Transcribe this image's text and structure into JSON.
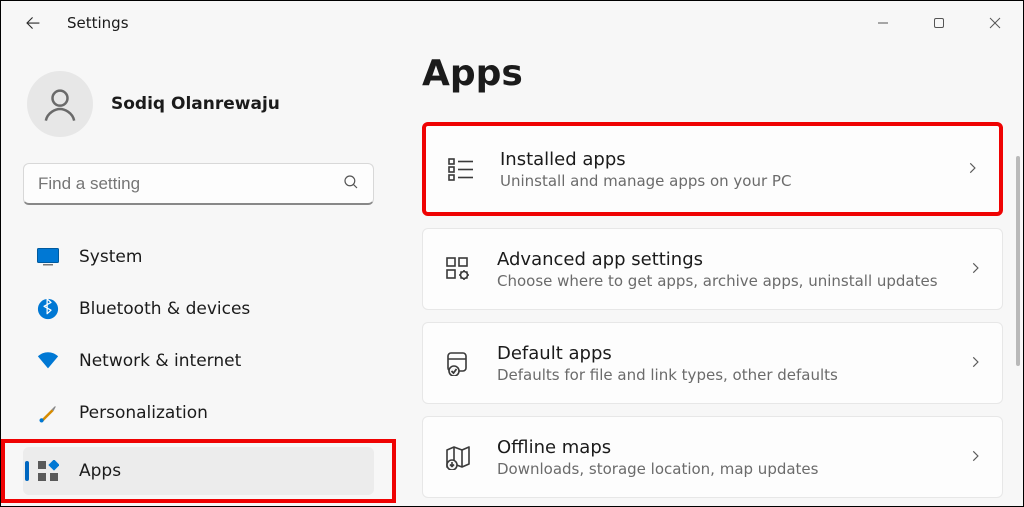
{
  "window": {
    "title": "Settings"
  },
  "profile": {
    "name": "Sodiq Olanrewaju"
  },
  "search": {
    "placeholder": "Find a setting"
  },
  "sidebar": {
    "items": [
      {
        "label": "System",
        "icon": "system"
      },
      {
        "label": "Bluetooth & devices",
        "icon": "bluetooth"
      },
      {
        "label": "Network & internet",
        "icon": "network"
      },
      {
        "label": "Personalization",
        "icon": "personalization"
      },
      {
        "label": "Apps",
        "icon": "apps",
        "selected": true,
        "highlighted": true
      }
    ]
  },
  "page": {
    "title": "Apps",
    "cards": [
      {
        "title": "Installed apps",
        "subtitle": "Uninstall and manage apps on your PC",
        "icon": "installed",
        "highlighted": true
      },
      {
        "title": "Advanced app settings",
        "subtitle": "Choose where to get apps, archive apps, uninstall updates",
        "icon": "advanced"
      },
      {
        "title": "Default apps",
        "subtitle": "Defaults for file and link types, other defaults",
        "icon": "defaults"
      },
      {
        "title": "Offline maps",
        "subtitle": "Downloads, storage location, map updates",
        "icon": "maps"
      }
    ]
  }
}
